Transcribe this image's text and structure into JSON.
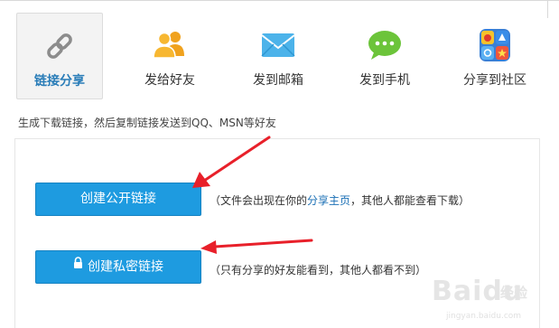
{
  "tabs": [
    {
      "label": "链接分享",
      "icon": "link-icon",
      "active": true
    },
    {
      "label": "发给好友",
      "icon": "friends-icon",
      "active": false
    },
    {
      "label": "发到邮箱",
      "icon": "mail-icon",
      "active": false
    },
    {
      "label": "发到手机",
      "icon": "message-bubble-icon",
      "active": false
    },
    {
      "label": "分享到社区",
      "icon": "community-apps-icon",
      "active": false
    }
  ],
  "description": "生成下载链接，然后复制链接发送到QQ、MSN等好友",
  "public_link": {
    "button_label": "创建公开链接",
    "note_before": "（文件会出现在你的",
    "note_link": "分享主页",
    "note_after": "，其他人都能查看下载）"
  },
  "private_link": {
    "button_label": "创建私密链接",
    "note": "（只有分享的好友能看到，其他人都看不到）"
  },
  "watermark": {
    "brand": "Baidu",
    "brand_cn": "经验",
    "url": "jingyan.baidu.com"
  },
  "colors": {
    "accent": "#1e9be0",
    "active_tab_label": "#2a7db8",
    "link": "#1a6fb5",
    "annotation_arrow": "#e8202a"
  }
}
